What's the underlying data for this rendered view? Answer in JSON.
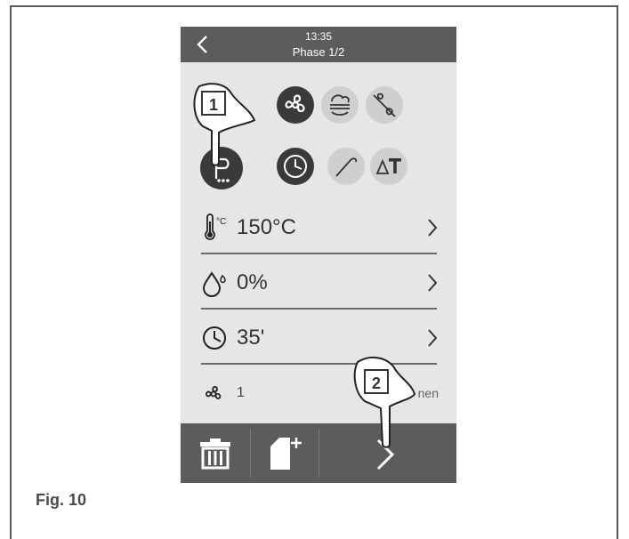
{
  "header": {
    "time": "13:35",
    "phase": "Phase 1/2"
  },
  "controls": {
    "row1": [
      "fan-icon",
      "humidity-icon",
      "fan-off-icon"
    ],
    "row2": [
      "preheat-icon",
      "timer-icon",
      "probe-icon",
      "delta-t-icon"
    ]
  },
  "settings": {
    "temperature": "150°C",
    "temperature_unit_icon": "°C",
    "humidity": "0%",
    "time": "35'",
    "fan_speed": "1",
    "fan_label": "nen"
  },
  "callouts": {
    "one": "1",
    "two": "2"
  },
  "figure_label": "Fig. 10",
  "colors": {
    "dark": "#3a3a3a",
    "bar": "#5c5c5c",
    "screen": "#e6e6e6"
  }
}
